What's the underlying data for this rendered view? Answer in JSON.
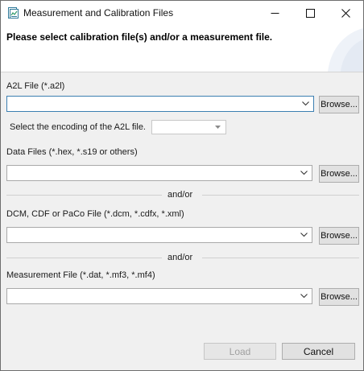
{
  "window": {
    "title": "Measurement and Calibration Files",
    "icon": "app-file-icon"
  },
  "banner": {
    "heading": "Please select calibration file(s) and/or a measurement file."
  },
  "a2l": {
    "label": "A2L File (*.a2l)",
    "value": "",
    "browse_label": "Browse...",
    "encoding_label": "Select the encoding of the A2L file.",
    "encoding_value": ""
  },
  "data_files": {
    "label": "Data Files (*.hex, *.s19 or others)",
    "value": "",
    "browse_label": "Browse..."
  },
  "separator1": {
    "text": "and/or"
  },
  "dcm": {
    "label": "DCM, CDF or PaCo File (*.dcm, *.cdfx, *.xml)",
    "value": "",
    "browse_label": "Browse..."
  },
  "separator2": {
    "text": "and/or"
  },
  "measurement": {
    "label": "Measurement File (*.dat, *.mf3, *.mf4)",
    "value": "",
    "browse_label": "Browse..."
  },
  "footer": {
    "load_label": "Load",
    "cancel_label": "Cancel"
  },
  "colors": {
    "focus_border": "#3c7fb1",
    "dialog_bg": "#f0f0f0",
    "button_bg": "#e1e1e1"
  }
}
